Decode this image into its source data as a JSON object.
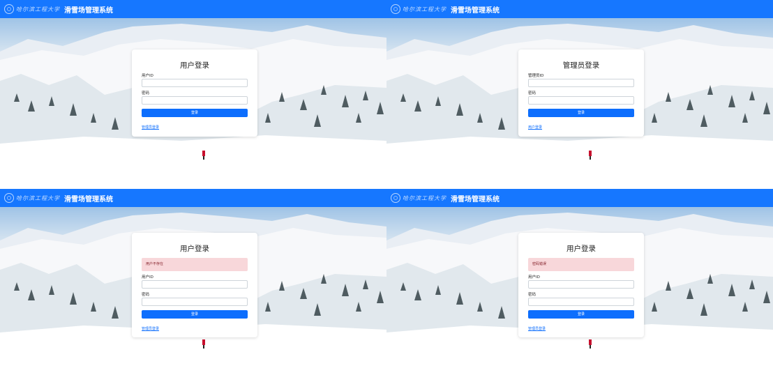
{
  "header": {
    "title": "滑雪场管理系统",
    "logo_script": "哈尔滨工程大学"
  },
  "panels": [
    {
      "form_title": "用户登录",
      "alert": "",
      "id_label": "用户ID",
      "password_label": "密码",
      "submit_label": "登录",
      "switch_link": "管理员登录"
    },
    {
      "form_title": "管理员登录",
      "alert": "",
      "id_label": "管理员ID",
      "password_label": "密码",
      "submit_label": "登录",
      "switch_link": "用户登录"
    },
    {
      "form_title": "用户登录",
      "alert": "用户不存在",
      "id_label": "用户ID",
      "password_label": "密码",
      "submit_label": "登录",
      "switch_link": "管理员登录"
    },
    {
      "form_title": "用户登录",
      "alert": "密码错误",
      "id_label": "用户ID",
      "password_label": "密码",
      "submit_label": "登录",
      "switch_link": "管理员登录"
    }
  ],
  "colors": {
    "navbar": "#1677ff",
    "primary_button": "#0d6efd",
    "alert_background": "#f8d7da",
    "alert_text": "#842029"
  }
}
